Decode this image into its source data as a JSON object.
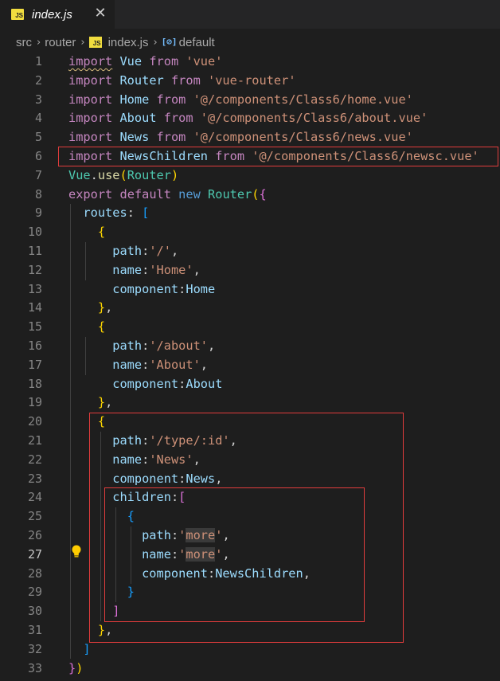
{
  "tab": {
    "label": "index.js",
    "badge": "JS",
    "close": "✕"
  },
  "breadcrumb": {
    "src": "src",
    "router": "router",
    "file": "index.js",
    "badge": "JS",
    "symbol_icon": "[⊘]",
    "symbol": "default"
  },
  "colors": {
    "editor_bg": "#1e1e1e",
    "keyword": "#c586c0",
    "string": "#ce9178",
    "class": "#4ec9b0",
    "variable": "#9cdcfe",
    "highlight_box": "#e03c3c"
  },
  "lines": [
    [
      [
        "import",
        "kw"
      ],
      [
        " Vue ",
        "var"
      ],
      [
        "from",
        "kw"
      ],
      [
        " ",
        "p"
      ],
      [
        "'vue'",
        "str"
      ]
    ],
    [
      [
        "import",
        "kw"
      ],
      [
        " Router ",
        "var"
      ],
      [
        "from",
        "kw"
      ],
      [
        " ",
        "p"
      ],
      [
        "'vue-router'",
        "str"
      ]
    ],
    [
      [
        "import",
        "kw"
      ],
      [
        " Home ",
        "var"
      ],
      [
        "from",
        "kw"
      ],
      [
        " ",
        "p"
      ],
      [
        "'@/components/Class6/home.vue'",
        "str"
      ]
    ],
    [
      [
        "import",
        "kw"
      ],
      [
        " About ",
        "var"
      ],
      [
        "from",
        "kw"
      ],
      [
        " ",
        "p"
      ],
      [
        "'@/components/Class6/about.vue'",
        "str"
      ]
    ],
    [
      [
        "import",
        "kw"
      ],
      [
        " News ",
        "var"
      ],
      [
        "from",
        "kw"
      ],
      [
        " ",
        "p"
      ],
      [
        "'@/components/Class6/news.vue'",
        "str"
      ]
    ],
    [
      [
        "import",
        "kw"
      ],
      [
        " NewsChildren ",
        "var"
      ],
      [
        "from",
        "kw"
      ],
      [
        " ",
        "p"
      ],
      [
        "'@/components/Class6/newsc.vue'",
        "str"
      ]
    ],
    [
      [
        "Vue",
        "cls"
      ],
      [
        ".",
        "p"
      ],
      [
        "use",
        "fn"
      ],
      [
        "(",
        "b1"
      ],
      [
        "Router",
        "cls"
      ],
      [
        ")",
        "b1"
      ]
    ],
    [
      [
        "export",
        "kw"
      ],
      [
        " ",
        "p"
      ],
      [
        "default",
        "kw"
      ],
      [
        " ",
        "p"
      ],
      [
        "new",
        "kw2"
      ],
      [
        " ",
        "p"
      ],
      [
        "Router",
        "cls"
      ],
      [
        "(",
        "b1"
      ],
      [
        "{",
        "b2"
      ]
    ],
    [
      [
        "  routes",
        "var"
      ],
      [
        ": ",
        "p"
      ],
      [
        "[",
        "b3"
      ]
    ],
    [
      [
        "    ",
        "p"
      ],
      [
        "{",
        "b1"
      ]
    ],
    [
      [
        "      path",
        "var"
      ],
      [
        ":",
        "p"
      ],
      [
        "'/'",
        "str"
      ],
      [
        ",",
        "p"
      ]
    ],
    [
      [
        "      name",
        "var"
      ],
      [
        ":",
        "p"
      ],
      [
        "'Home'",
        "str"
      ],
      [
        ",",
        "p"
      ]
    ],
    [
      [
        "      component",
        "var"
      ],
      [
        ":",
        "p"
      ],
      [
        "Home",
        "var"
      ]
    ],
    [
      [
        "    ",
        "p"
      ],
      [
        "}",
        "b1"
      ],
      [
        ",",
        "p"
      ]
    ],
    [
      [
        "    ",
        "p"
      ],
      [
        "{",
        "b1"
      ]
    ],
    [
      [
        "      path",
        "var"
      ],
      [
        ":",
        "p"
      ],
      [
        "'/about'",
        "str"
      ],
      [
        ",",
        "p"
      ]
    ],
    [
      [
        "      name",
        "var"
      ],
      [
        ":",
        "p"
      ],
      [
        "'About'",
        "str"
      ],
      [
        ",",
        "p"
      ]
    ],
    [
      [
        "      component",
        "var"
      ],
      [
        ":",
        "p"
      ],
      [
        "About",
        "var"
      ]
    ],
    [
      [
        "    ",
        "p"
      ],
      [
        "}",
        "b1"
      ],
      [
        ",",
        "p"
      ]
    ],
    [
      [
        "    ",
        "p"
      ],
      [
        "{",
        "b1"
      ]
    ],
    [
      [
        "      path",
        "var"
      ],
      [
        ":",
        "p"
      ],
      [
        "'/type/:id'",
        "str"
      ],
      [
        ",",
        "p"
      ]
    ],
    [
      [
        "      name",
        "var"
      ],
      [
        ":",
        "p"
      ],
      [
        "'News'",
        "str"
      ],
      [
        ",",
        "p"
      ]
    ],
    [
      [
        "      component",
        "var"
      ],
      [
        ":",
        "p"
      ],
      [
        "News",
        "var"
      ],
      [
        ",",
        "p"
      ]
    ],
    [
      [
        "      children",
        "var"
      ],
      [
        ":",
        "p"
      ],
      [
        "[",
        "b2"
      ]
    ],
    [
      [
        "        ",
        "p"
      ],
      [
        "{",
        "b3"
      ]
    ],
    [
      [
        "          path",
        "var"
      ],
      [
        ":",
        "p"
      ],
      [
        "'",
        "str"
      ],
      [
        "more",
        "str hl"
      ],
      [
        "'",
        "str"
      ],
      [
        ",",
        "p"
      ]
    ],
    [
      [
        "          name",
        "var"
      ],
      [
        ":",
        "p"
      ],
      [
        "'",
        "str"
      ],
      [
        "more",
        "str hl"
      ],
      [
        "'",
        "str"
      ],
      [
        ",",
        "p"
      ]
    ],
    [
      [
        "          component",
        "var"
      ],
      [
        ":",
        "p"
      ],
      [
        "NewsChildren",
        "var"
      ],
      [
        ",",
        "p"
      ]
    ],
    [
      [
        "        ",
        "p"
      ],
      [
        "}",
        "b3"
      ]
    ],
    [
      [
        "      ",
        "p"
      ],
      [
        "]",
        "b2"
      ]
    ],
    [
      [
        "    ",
        "p"
      ],
      [
        "}",
        "b1"
      ],
      [
        ",",
        "p"
      ]
    ],
    [
      [
        "  ",
        "p"
      ],
      [
        "]",
        "b3"
      ]
    ],
    [
      [
        "}",
        "b2"
      ],
      [
        ")",
        "b1"
      ]
    ]
  ]
}
